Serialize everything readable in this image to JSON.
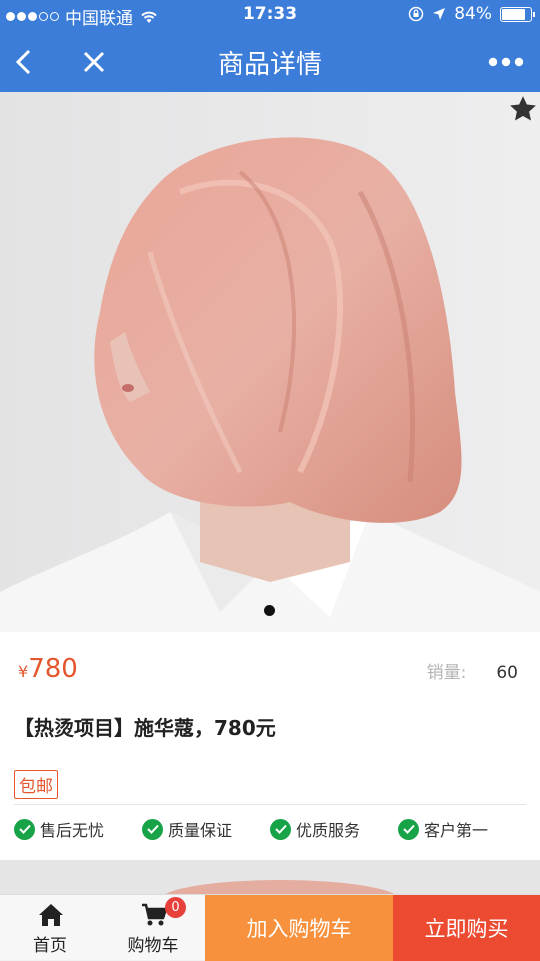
{
  "status_bar": {
    "carrier": "中国联通",
    "time": "17:33",
    "battery": "84%",
    "battery_level": 0.84
  },
  "nav": {
    "title": "商品详情"
  },
  "product": {
    "currency": "¥",
    "price": "780",
    "sales_label": "销量:",
    "sales_value": "60",
    "title": "【热烫项目】施华蔻，780元",
    "tag": "包邮",
    "guarantees": [
      "售后无忧",
      "质量保证",
      "优质服务",
      "客户第一"
    ]
  },
  "tabbar": {
    "home": "首页",
    "cart": "购物车",
    "cart_badge": "0",
    "add_to_cart": "加入购物车",
    "buy_now": "立即购买"
  },
  "colors": {
    "nav": "#3b7dd8",
    "price": "#e4572e",
    "check": "#18a347",
    "add_cart": "#f7913d",
    "buy": "#ec4a31"
  }
}
